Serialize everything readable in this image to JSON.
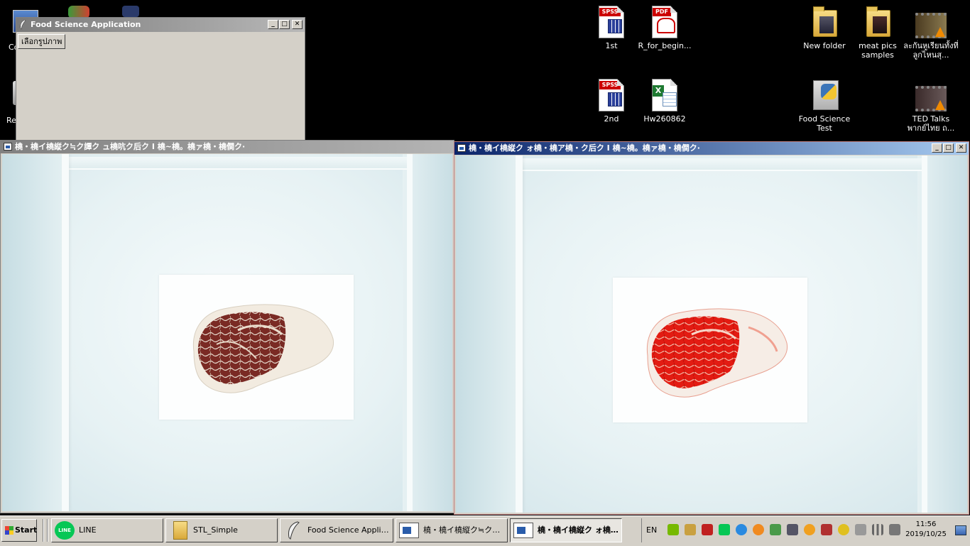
{
  "desktop": {
    "left_icons": [
      {
        "label": "Co"
      },
      {
        "label": "Re"
      }
    ],
    "icons": [
      {
        "label": "1st",
        "icon": "spss-data-icon"
      },
      {
        "label": "R_for_begin...",
        "icon": "pdf-icon"
      },
      {
        "label": "2nd",
        "icon": "spss-data-icon"
      },
      {
        "label": "Hw260862",
        "icon": "excel-icon"
      },
      {
        "label": "New folder",
        "icon": "folder-icon"
      },
      {
        "label": "meat pics samples",
        "icon": "folder-icon"
      },
      {
        "label": "ละกันหูเรียนทั้งที่ ลูกไหนสุ...",
        "icon": "video-icon"
      },
      {
        "label": "Food Science Test",
        "icon": "python-file-icon"
      },
      {
        "label": "TED Talks พากย์ไทย ถ...",
        "icon": "video-icon"
      }
    ]
  },
  "app_window": {
    "title": "Food Science Application",
    "button_label": "เลือกรูปภาพ",
    "controls": {
      "minimize": "_",
      "maximize": "□",
      "close": "✕"
    }
  },
  "image_windows": [
    {
      "title": "橈・橈イ橈縦ク≒ク譚ク ュ橈吭ク后ク I 橈~橈。橈ァ橈・橈僴ク·",
      "state": "inactive",
      "description_meat": "raw"
    },
    {
      "title": "橈・橈イ橈縦ク ォ橈・橈ア橈・ク后ク I 橈~橈。橈ァ橈・橈僴ク·",
      "state": "active",
      "description_meat": "highlighted"
    }
  ],
  "taskbar": {
    "start_label": "Start",
    "items": [
      {
        "label": "LINE",
        "icon": "line-icon"
      },
      {
        "label": "STL_Simple",
        "icon": "folder-icon"
      },
      {
        "label": "Food Science Applicat...",
        "icon": "feather-icon"
      },
      {
        "label": "橈・橈イ橈縦ク≒ク譚ク...",
        "icon": "image-window-icon"
      },
      {
        "label": "橈・橈イ橈縦ク ォ橈・...",
        "icon": "image-window-icon",
        "active": true
      }
    ],
    "tray": {
      "language": "EN",
      "time": "11:56",
      "date": "2019/10/25"
    }
  },
  "colors": {
    "desktop_bg": "#000000",
    "active_title": "#0a246a",
    "inactive_title": "#808080",
    "meat_highlight": "#e31b12"
  }
}
